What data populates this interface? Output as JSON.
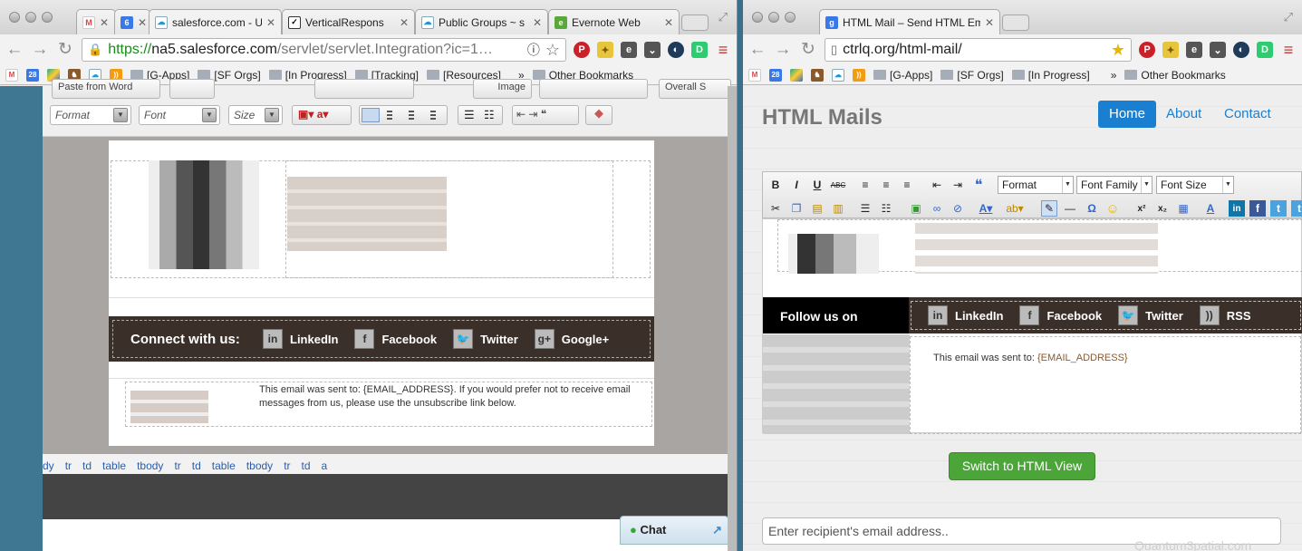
{
  "left_window": {
    "tabs": [
      {
        "icon": "gmail-icon",
        "label": ""
      },
      {
        "icon": "calendar-6-icon",
        "label": ""
      },
      {
        "icon": "salesforce-icon",
        "label": "salesforce.com - U"
      },
      {
        "icon": "verticalresponse-icon",
        "label": "VerticalRespons"
      },
      {
        "icon": "public-groups-icon",
        "label": "Public Groups ~ s"
      },
      {
        "icon": "evernote-icon",
        "label": "Evernote Web"
      }
    ],
    "url_scheme": "https://",
    "url_host": "na5.salesforce.com",
    "url_rest": "/servlet/servlet.Integration?ic=1…",
    "bookmarks": [
      "[G-Apps]",
      "[SF Orgs]",
      "[In Progress]",
      "[Tracking]",
      "[Resources]"
    ],
    "other_bookmarks": "Other Bookmarks",
    "bm_overflow": "»",
    "top_toolbar_partial": [
      "Paste from Word",
      "Image",
      "Overall S"
    ],
    "format_select": "Format",
    "font_select": "Font",
    "size_select": "Size",
    "connect_text": "Connect with us:",
    "social": [
      "LinkedIn",
      "Facebook",
      "Twitter",
      "Google+"
    ],
    "email_notice": "This email was sent to: {EMAIL_ADDRESS}. If you would prefer not to receive email messages from us, please use the unsubscribe link below.",
    "breadcrumbs": [
      "dy",
      "tr",
      "td",
      "table",
      "tbody",
      "tr",
      "td",
      "table",
      "tbody",
      "tr",
      "td",
      "a"
    ],
    "chat_label": "Chat"
  },
  "right_window": {
    "tab_label": "HTML Mail – Send HTML Em",
    "url": "ctrlq.org/html-mail/",
    "bookmarks": [
      "[G-Apps]",
      "[SF Orgs]",
      "[In Progress]"
    ],
    "bm_overflow": "»",
    "other_bookmarks": "Other Bookmarks",
    "site_title": "HTML Mails",
    "nav": [
      "Home",
      "About",
      "Contact"
    ],
    "format_select": "Format",
    "font_family_select": "Font Family",
    "font_size_select": "Font Size",
    "follow_text": "Follow us on",
    "social": [
      "LinkedIn",
      "Facebook",
      "Twitter",
      "RSS"
    ],
    "email_notice_prefix": "This email was sent to:",
    "email_notice_var": "{EMAIL_ADDRESS}",
    "switch_button": "Switch to HTML View",
    "recipient_placeholder": "Enter recipient's email address..",
    "watermark": "Quantum3patial.com"
  },
  "colors": {
    "bootstrap_primary": "#1a7fd0",
    "switch_green": "#4ba538",
    "social_bar": "#3b2f2a"
  }
}
